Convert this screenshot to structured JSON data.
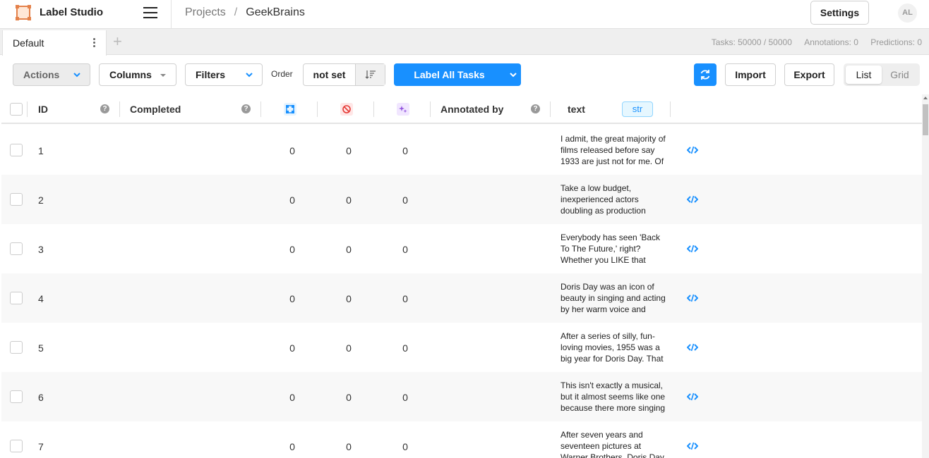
{
  "app": {
    "name": "Label Studio",
    "avatar_initials": "AL",
    "settings_label": "Settings"
  },
  "breadcrumb": {
    "projects": "Projects",
    "separator": "/",
    "project": "GeekBrains"
  },
  "tabs": [
    {
      "label": "Default"
    }
  ],
  "stats": {
    "tasks": "Tasks: 50000 / 50000",
    "annotations": "Annotations: 0",
    "predictions": "Predictions: 0"
  },
  "toolbar": {
    "actions_label": "Actions",
    "columns_label": "Columns",
    "filters_label": "Filters",
    "order_label": "Order",
    "order_value": "not set",
    "label_all_label": "Label All Tasks",
    "import_label": "Import",
    "export_label": "Export",
    "view_list_label": "List",
    "view_grid_label": "Grid",
    "view_selected": "List",
    "accent_color": "#1890ff"
  },
  "table": {
    "columns": {
      "id": "ID",
      "completed": "Completed",
      "total_annotations_icon": "annotations-icon",
      "cancelled_icon": "cancelled-icon",
      "predictions_icon": "predictions-icon",
      "annotated_by": "Annotated by",
      "text": "text",
      "text_type": "str"
    },
    "rows": [
      {
        "id": "1",
        "completed": "",
        "annotations": "0",
        "cancelled": "0",
        "predictions": "0",
        "text": "I admit, the great majority of films released before say 1933 are just not for me. Of"
      },
      {
        "id": "2",
        "completed": "",
        "annotations": "0",
        "cancelled": "0",
        "predictions": "0",
        "text": "Take a low budget, inexperienced actors doubling as production"
      },
      {
        "id": "3",
        "completed": "",
        "annotations": "0",
        "cancelled": "0",
        "predictions": "0",
        "text": "Everybody has seen 'Back To The Future,' right? Whether you LIKE that"
      },
      {
        "id": "4",
        "completed": "",
        "annotations": "0",
        "cancelled": "0",
        "predictions": "0",
        "text": "Doris Day was an icon of beauty in singing and acting by her warm voice and"
      },
      {
        "id": "5",
        "completed": "",
        "annotations": "0",
        "cancelled": "0",
        "predictions": "0",
        "text": "After a series of silly, fun-loving movies, 1955 was a big year for Doris Day. That"
      },
      {
        "id": "6",
        "completed": "",
        "annotations": "0",
        "cancelled": "0",
        "predictions": "0",
        "text": "This isn't exactly a musical, but it almost seems like one because there more singing"
      },
      {
        "id": "7",
        "completed": "",
        "annotations": "0",
        "cancelled": "0",
        "predictions": "0",
        "text": "After seven years and seventeen pictures at Warner Brothers, Doris Day"
      }
    ]
  }
}
